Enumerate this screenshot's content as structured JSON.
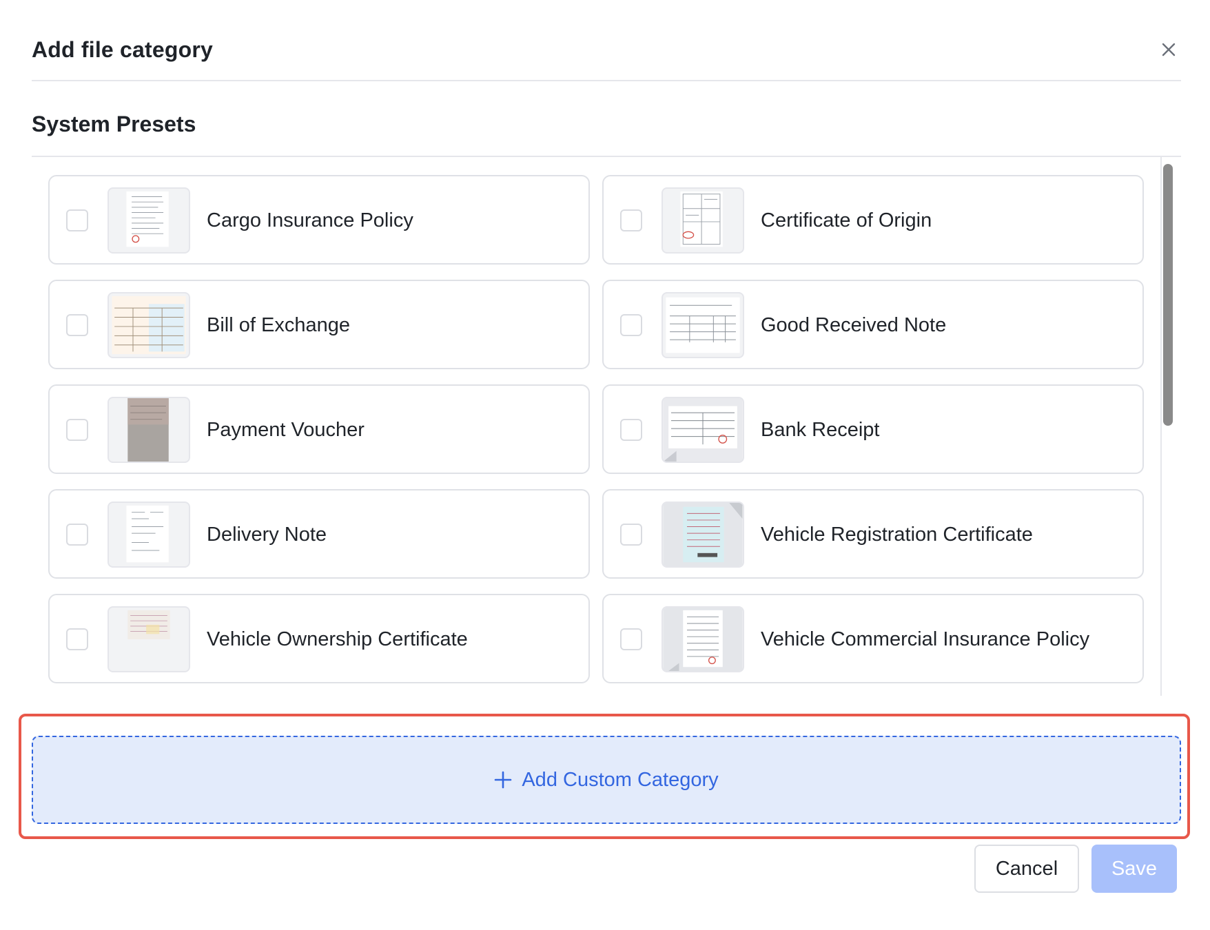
{
  "dialog": {
    "title": "Add file category",
    "close_icon": "close-icon"
  },
  "presets": {
    "section_title": "System Presets",
    "items": [
      {
        "label": "Cargo Insurance Policy",
        "checked": false,
        "thumb_icon": "document-thumbnail"
      },
      {
        "label": "Certificate of Origin",
        "checked": false,
        "thumb_icon": "document-thumbnail"
      },
      {
        "label": "Bill of Exchange",
        "checked": false,
        "thumb_icon": "document-thumbnail"
      },
      {
        "label": "Good Received Note",
        "checked": false,
        "thumb_icon": "document-thumbnail"
      },
      {
        "label": "Payment Voucher",
        "checked": false,
        "thumb_icon": "photo-thumbnail"
      },
      {
        "label": "Bank Receipt",
        "checked": false,
        "thumb_icon": "document-thumbnail"
      },
      {
        "label": "Delivery Note",
        "checked": false,
        "thumb_icon": "document-thumbnail"
      },
      {
        "label": "Vehicle Registration Certificate",
        "checked": false,
        "thumb_icon": "document-thumbnail"
      },
      {
        "label": "Vehicle Ownership Certificate",
        "checked": false,
        "thumb_icon": "document-thumbnail"
      },
      {
        "label": "Vehicle Commercial Insurance Policy",
        "checked": false,
        "thumb_icon": "document-thumbnail"
      }
    ]
  },
  "add_custom": {
    "label": "Add Custom Category",
    "icon": "plus-icon"
  },
  "footer": {
    "cancel_label": "Cancel",
    "save_label": "Save",
    "save_enabled": false
  },
  "colors": {
    "accent": "#3366e0",
    "accent_bg": "#e3ebfb",
    "highlight": "#e8584a",
    "save_disabled": "#a8c0fb"
  }
}
